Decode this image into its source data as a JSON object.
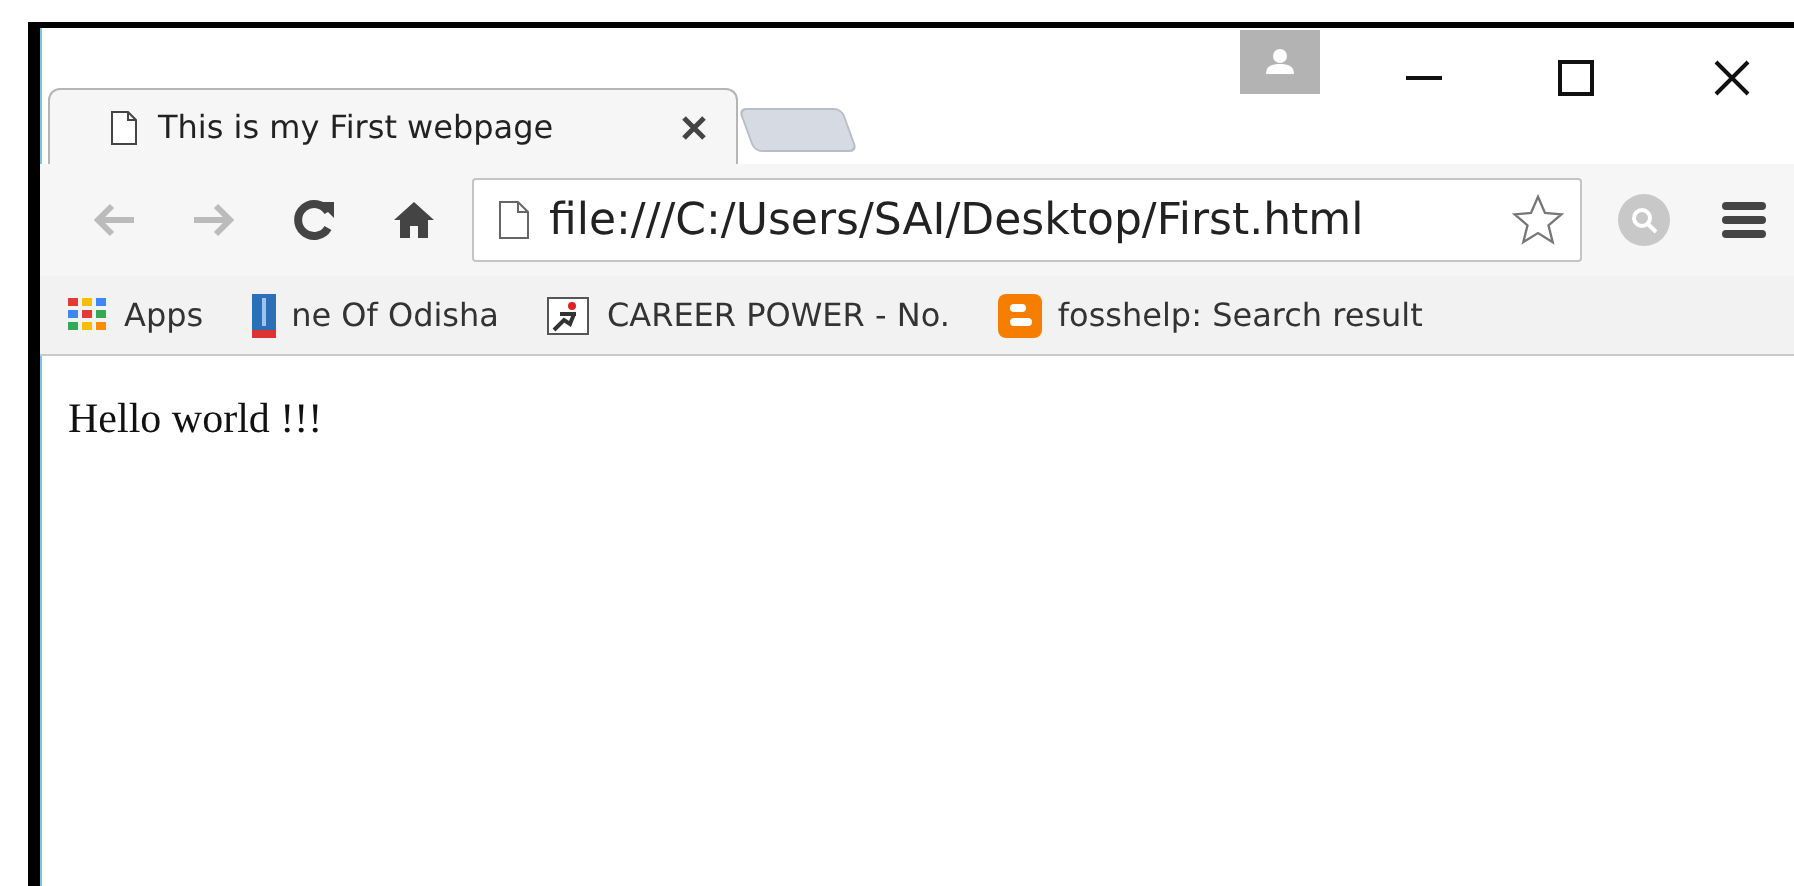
{
  "tabs": [
    {
      "title": "This is my First webpage",
      "selected": true
    }
  ],
  "address_bar": {
    "value": "file:///C:/Users/SAI/Desktop/First.html"
  },
  "bookmarks": [
    {
      "label": "Apps",
      "kind": "apps"
    },
    {
      "label": "ne Of Odisha",
      "kind": "building"
    },
    {
      "label": "CAREER POWER - No.",
      "kind": "runner"
    },
    {
      "label": "fosshelp: Search result",
      "kind": "blogger"
    }
  ],
  "page": {
    "text": "Hello world !!!"
  }
}
